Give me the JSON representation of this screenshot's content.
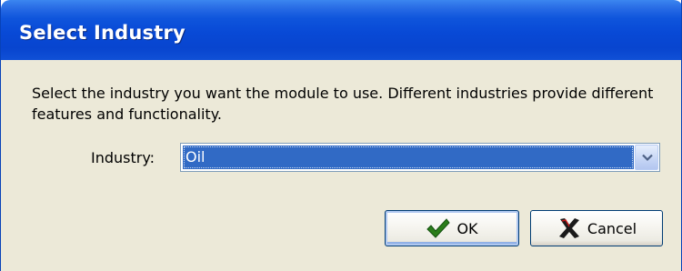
{
  "window": {
    "title": "Select Industry"
  },
  "dialog": {
    "description": "Select the industry you want the module to use. Different industries provide different features and functionality.",
    "industry_label": "Industry:",
    "industry_value": "Oil"
  },
  "buttons": {
    "ok_label": "OK",
    "cancel_label": "Cancel"
  },
  "icons": {
    "ok": "checkmark-icon",
    "cancel": "x-icon",
    "dropdown": "chevron-down-icon"
  },
  "colors": {
    "titlebar": "#0849d6",
    "selection": "#316ac5",
    "dialog_background": "#ece9d8",
    "ok_check": "#2a7d1a",
    "cancel_x": "#1a1a1a"
  }
}
